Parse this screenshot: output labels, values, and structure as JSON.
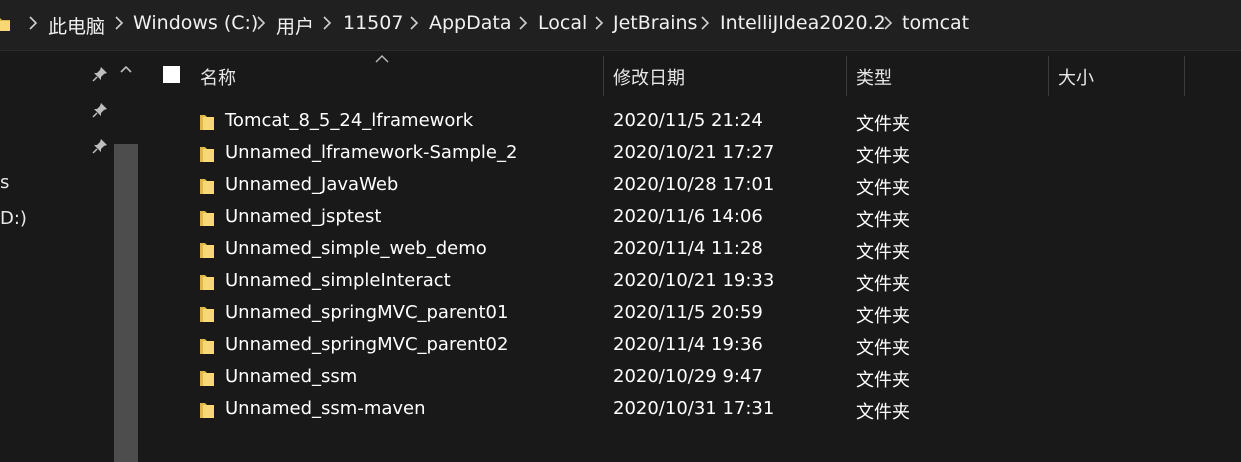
{
  "breadcrumb": {
    "items": [
      "此电脑",
      "Windows (C:)",
      "用户",
      "11507",
      "AppData",
      "Local",
      "JetBrains",
      "IntelliJIdea2020.2",
      "tomcat"
    ]
  },
  "nav": {
    "partial_items": [
      "s",
      "D:)"
    ]
  },
  "columns": {
    "name": "名称",
    "date": "修改日期",
    "type": "类型",
    "size": "大小"
  },
  "files": [
    {
      "name": "Tomcat_8_5_24_lframework",
      "date": "2020/11/5 21:24",
      "type": "文件夹"
    },
    {
      "name": "Unnamed_lframework-Sample_2",
      "date": "2020/10/21 17:27",
      "type": "文件夹"
    },
    {
      "name": "Unnamed_JavaWeb",
      "date": "2020/10/28 17:01",
      "type": "文件夹"
    },
    {
      "name": "Unnamed_jsptest",
      "date": "2020/11/6 14:06",
      "type": "文件夹"
    },
    {
      "name": "Unnamed_simple_web_demo",
      "date": "2020/11/4 11:28",
      "type": "文件夹"
    },
    {
      "name": "Unnamed_simpleInteract",
      "date": "2020/10/21 19:33",
      "type": "文件夹"
    },
    {
      "name": "Unnamed_springMVC_parent01",
      "date": "2020/11/5 20:59",
      "type": "文件夹"
    },
    {
      "name": "Unnamed_springMVC_parent02",
      "date": "2020/11/4 19:36",
      "type": "文件夹"
    },
    {
      "name": "Unnamed_ssm",
      "date": "2020/10/29 9:47",
      "type": "文件夹"
    },
    {
      "name": "Unnamed_ssm-maven",
      "date": "2020/10/31 17:31",
      "type": "文件夹"
    }
  ],
  "icons": {
    "folder": "folder-icon",
    "pin": "pin-icon",
    "separator": "chevron-right-icon"
  },
  "colors": {
    "background": "#191919",
    "breadcrumb_bg": "#202020",
    "folder_yellow": "#f8d775",
    "folder_dark": "#e0b54c",
    "scrollbar": "#4d4d4d"
  }
}
